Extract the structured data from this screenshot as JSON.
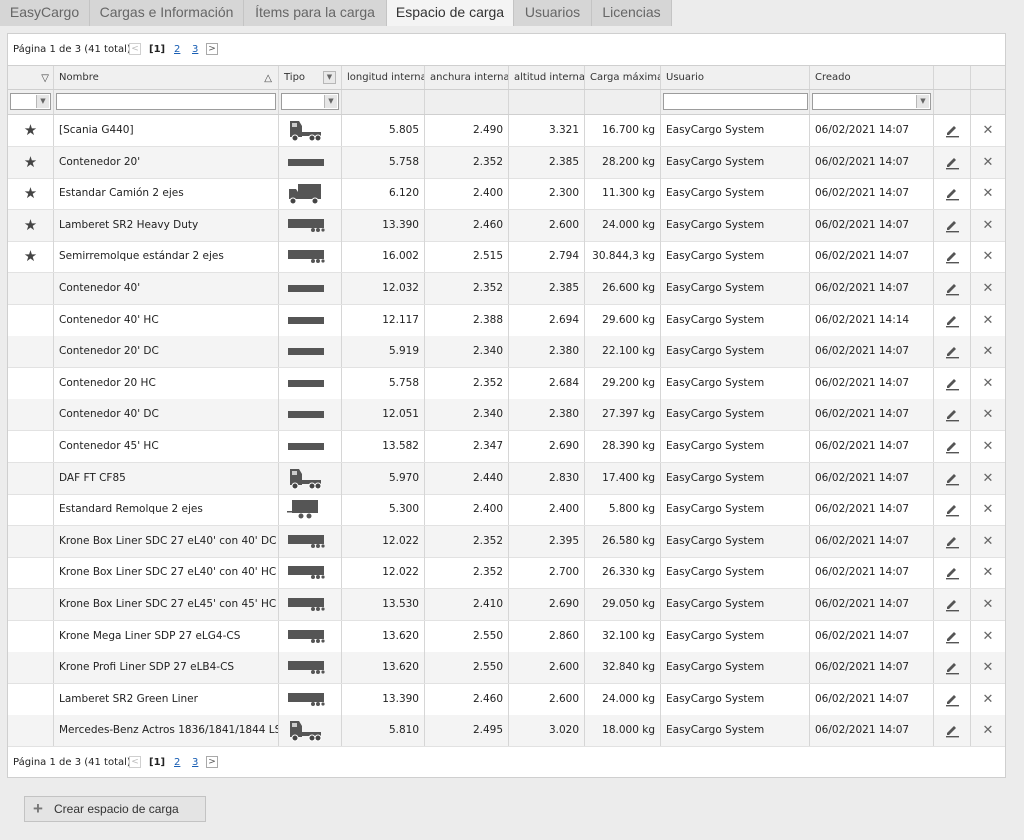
{
  "tabs": [
    {
      "label": "EasyCargo",
      "active": false
    },
    {
      "label": "Cargas e Información",
      "active": false
    },
    {
      "label": "Ítems para la carga",
      "active": false
    },
    {
      "label": "Espacio de carga",
      "active": true
    },
    {
      "label": "Usuarios",
      "active": false
    },
    {
      "label": "Licencias",
      "active": false
    }
  ],
  "pager": {
    "text": "Página 1 de 3 (41 total)",
    "prev": "<",
    "current": "[1]",
    "page2": "2",
    "page3": "3",
    "next": ">"
  },
  "columns": {
    "nombre": "Nombre",
    "tipo": "Tipo",
    "longitud": "longitud interna",
    "anchura": "anchura interna",
    "altitud": "altitud interna",
    "carga": "Carga máxima",
    "usuario": "Usuario",
    "creado": "Creado"
  },
  "icons": {
    "star": "star-icon",
    "edit": "pencil-icon",
    "delete": "close-icon"
  },
  "rows": [
    {
      "fav": true,
      "name": "[Scania G440]",
      "type": "tractor",
      "l": "5.805",
      "w": "2.490",
      "h": "3.321",
      "load": "16.700 kg",
      "user": "EasyCargo System",
      "created": "06/02/2021 14:07"
    },
    {
      "fav": true,
      "name": "Contenedor 20'",
      "type": "container",
      "l": "5.758",
      "w": "2.352",
      "h": "2.385",
      "load": "28.200 kg",
      "user": "EasyCargo System",
      "created": "06/02/2021 14:07"
    },
    {
      "fav": true,
      "name": "Estandar Camión 2 ejes",
      "type": "truck",
      "l": "6.120",
      "w": "2.400",
      "h": "2.300",
      "load": "11.300 kg",
      "user": "EasyCargo System",
      "created": "06/02/2021 14:07"
    },
    {
      "fav": true,
      "name": "Lamberet SR2 Heavy Duty",
      "type": "trailer",
      "l": "13.390",
      "w": "2.460",
      "h": "2.600",
      "load": "24.000 kg",
      "user": "EasyCargo System",
      "created": "06/02/2021 14:07"
    },
    {
      "fav": true,
      "name": "Semirremolque estándar 2 ejes",
      "type": "trailer",
      "l": "16.002",
      "w": "2.515",
      "h": "2.794",
      "load": "30.844,3 kg",
      "user": "EasyCargo System",
      "created": "06/02/2021 14:07"
    },
    {
      "fav": false,
      "name": "Contenedor 40'",
      "type": "container",
      "l": "12.032",
      "w": "2.352",
      "h": "2.385",
      "load": "26.600 kg",
      "user": "EasyCargo System",
      "created": "06/02/2021 14:07"
    },
    {
      "fav": false,
      "name": "Contenedor 40' HC",
      "type": "container",
      "l": "12.117",
      "w": "2.388",
      "h": "2.694",
      "load": "29.600 kg",
      "user": "EasyCargo System",
      "created": "06/02/2021 14:14"
    },
    {
      "fav": false,
      "name": "Contenedor 20' DC",
      "type": "container",
      "l": "5.919",
      "w": "2.340",
      "h": "2.380",
      "load": "22.100 kg",
      "user": "EasyCargo System",
      "created": "06/02/2021 14:07"
    },
    {
      "fav": false,
      "name": "Contenedor 20 HC",
      "type": "container",
      "l": "5.758",
      "w": "2.352",
      "h": "2.684",
      "load": "29.200 kg",
      "user": "EasyCargo System",
      "created": "06/02/2021 14:07"
    },
    {
      "fav": false,
      "name": "Contenedor 40' DC",
      "type": "container",
      "l": "12.051",
      "w": "2.340",
      "h": "2.380",
      "load": "27.397 kg",
      "user": "EasyCargo System",
      "created": "06/02/2021 14:07"
    },
    {
      "fav": false,
      "name": "Contenedor 45' HC",
      "type": "container",
      "l": "13.582",
      "w": "2.347",
      "h": "2.690",
      "load": "28.390 kg",
      "user": "EasyCargo System",
      "created": "06/02/2021 14:07"
    },
    {
      "fav": false,
      "name": "DAF FT CF85",
      "type": "tractor",
      "l": "5.970",
      "w": "2.440",
      "h": "2.830",
      "load": "17.400 kg",
      "user": "EasyCargo System",
      "created": "06/02/2021 14:07"
    },
    {
      "fav": false,
      "name": "Estandard Remolque 2 ejes",
      "type": "trailer-small",
      "l": "5.300",
      "w": "2.400",
      "h": "2.400",
      "load": "5.800 kg",
      "user": "EasyCargo System",
      "created": "06/02/2021 14:07"
    },
    {
      "fav": false,
      "name": "Krone Box Liner SDC 27 eL40' con 40' DC",
      "type": "trailer",
      "l": "12.022",
      "w": "2.352",
      "h": "2.395",
      "load": "26.580 kg",
      "user": "EasyCargo System",
      "created": "06/02/2021 14:07"
    },
    {
      "fav": false,
      "name": "Krone Box Liner SDC 27 eL40' con 40' HC",
      "type": "trailer",
      "l": "12.022",
      "w": "2.352",
      "h": "2.700",
      "load": "26.330 kg",
      "user": "EasyCargo System",
      "created": "06/02/2021 14:07"
    },
    {
      "fav": false,
      "name": "Krone Box Liner SDC 27 eL45' con 45' HC",
      "type": "trailer",
      "l": "13.530",
      "w": "2.410",
      "h": "2.690",
      "load": "29.050 kg",
      "user": "EasyCargo System",
      "created": "06/02/2021 14:07"
    },
    {
      "fav": false,
      "name": "Krone Mega Liner SDP 27 eLG4-CS",
      "type": "trailer",
      "l": "13.620",
      "w": "2.550",
      "h": "2.860",
      "load": "32.100 kg",
      "user": "EasyCargo System",
      "created": "06/02/2021 14:07"
    },
    {
      "fav": false,
      "name": "Krone Profi Liner SDP 27 eLB4-CS",
      "type": "trailer",
      "l": "13.620",
      "w": "2.550",
      "h": "2.600",
      "load": "32.840 kg",
      "user": "EasyCargo System",
      "created": "06/02/2021 14:07"
    },
    {
      "fav": false,
      "name": "Lamberet SR2 Green Liner",
      "type": "trailer",
      "l": "13.390",
      "w": "2.460",
      "h": "2.600",
      "load": "24.000 kg",
      "user": "EasyCargo System",
      "created": "06/02/2021 14:07"
    },
    {
      "fav": false,
      "name": "Mercedes-Benz Actros 1836/1841/1844 LS",
      "type": "tractor",
      "l": "5.810",
      "w": "2.495",
      "h": "3.020",
      "load": "18.000 kg",
      "user": "EasyCargo System",
      "created": "06/02/2021 14:07"
    }
  ],
  "create_button": "Crear espacio de carga"
}
